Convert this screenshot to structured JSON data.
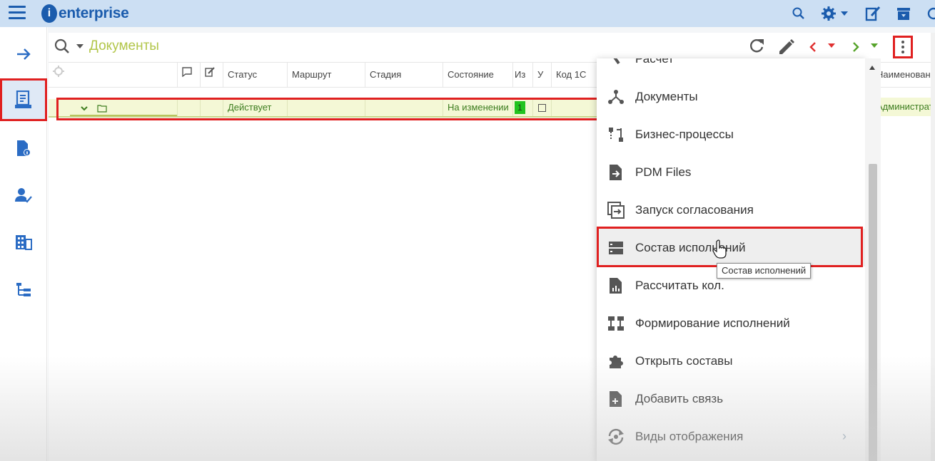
{
  "app": {
    "brand_mark": "i",
    "brand": "enterprise"
  },
  "panel": {
    "title": "Документы"
  },
  "table": {
    "headers": [
      "Статус",
      "Маршрут",
      "Стадия",
      "Состояние",
      "Из",
      "У",
      "Код 1С"
    ],
    "row": {
      "status": "Действует",
      "state": "На изменении",
      "count": "1"
    },
    "right_header": "Наименование",
    "right_cell": "Администратор панели"
  },
  "menu": {
    "items": [
      {
        "label": "Расчет",
        "icon": "calc-icon"
      },
      {
        "label": "Документы",
        "icon": "network-icon"
      },
      {
        "label": "Бизнес-процессы",
        "icon": "process-icon"
      },
      {
        "label": "PDM Files",
        "icon": "file-arrow-icon"
      },
      {
        "label": "Запуск согласования",
        "icon": "launch-icon"
      },
      {
        "label": "Состав исполнений",
        "icon": "server-icon"
      },
      {
        "label": "Рассчитать кол.",
        "icon": "file-chart-icon"
      },
      {
        "label": "Формирование исполнений",
        "icon": "layout-icon"
      },
      {
        "label": "Открыть составы",
        "icon": "puzzle-icon"
      },
      {
        "label": "Добавить связь",
        "icon": "file-plus-icon"
      },
      {
        "label": "Виды отображения",
        "icon": "sync-icon"
      }
    ],
    "tooltip": "Состав исполнений",
    "submenu_arrow": "›"
  },
  "colors": {
    "accent": "#1b5cad",
    "title": "#b2c64a",
    "highlight": "#e02020",
    "row_bg": "#f4f8d6",
    "badge": "#22c31f"
  }
}
